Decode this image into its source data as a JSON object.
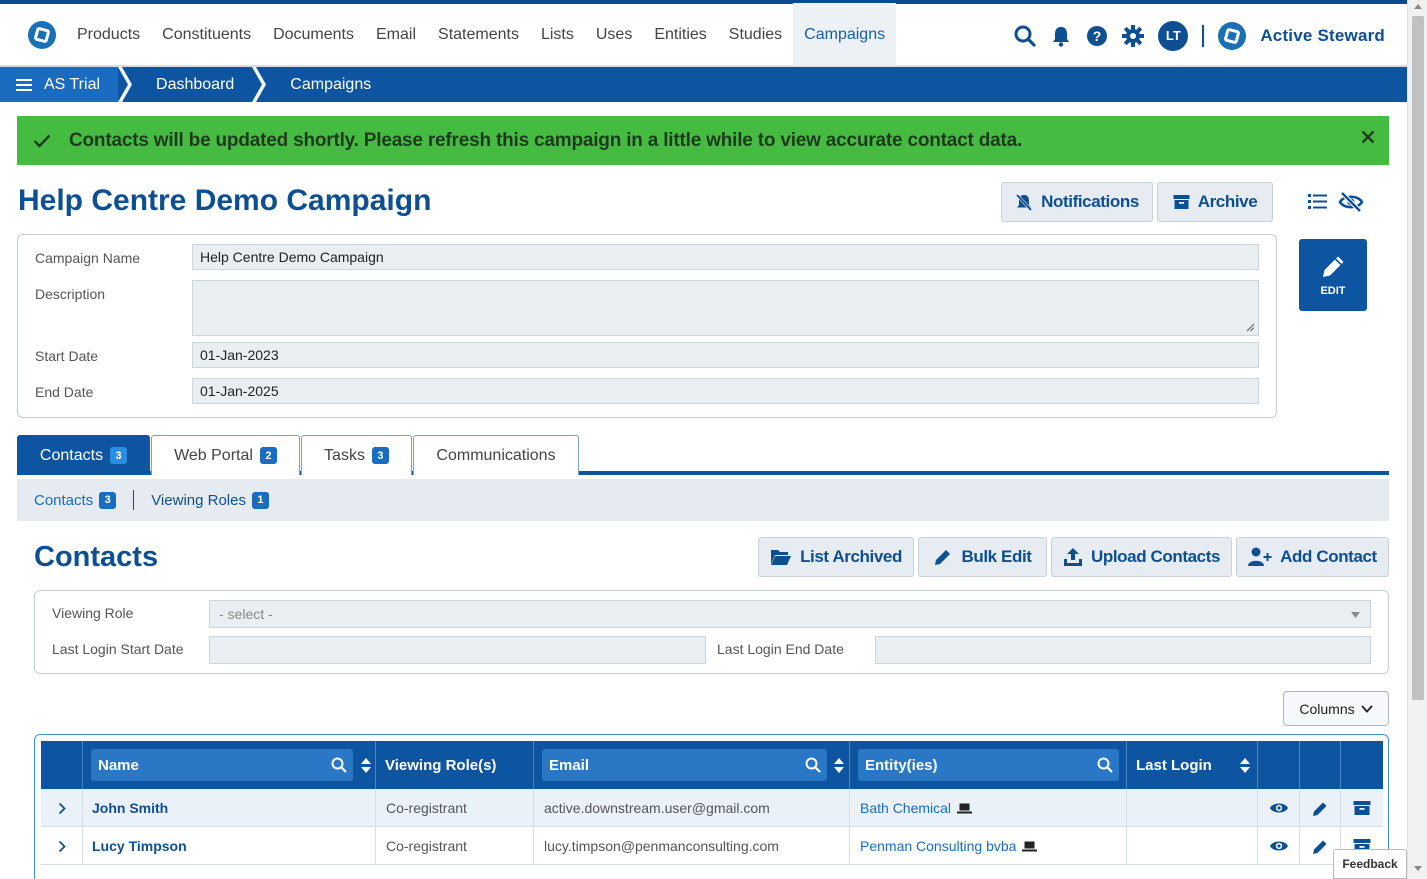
{
  "nav": {
    "items": [
      "Products",
      "Constituents",
      "Documents",
      "Email",
      "Statements",
      "Lists",
      "Uses",
      "Entities",
      "Studies",
      "Campaigns"
    ],
    "active": "Campaigns",
    "user_initials": "LT",
    "brand": "Active Steward",
    "icons": [
      "search-icon",
      "bell-icon",
      "help-icon",
      "gear-icon"
    ]
  },
  "breadcrumb": [
    "AS Trial",
    "Dashboard",
    "Campaigns"
  ],
  "alert": {
    "text": "Contacts will be updated shortly. Please refresh this campaign in a little while to view accurate contact data.",
    "color": "#45bc41"
  },
  "page": {
    "title": "Help Centre Demo Campaign",
    "notifications_label": "Notifications",
    "archive_label": "Archive",
    "edit_label": "EDIT"
  },
  "form": {
    "campaign_name_label": "Campaign Name",
    "campaign_name_value": "Help Centre Demo Campaign",
    "description_label": "Description",
    "description_value": "",
    "start_date_label": "Start Date",
    "start_date_value": "01-Jan-2023",
    "end_date_label": "End Date",
    "end_date_value": "01-Jan-2025"
  },
  "tabs": [
    {
      "label": "Contacts",
      "count": "3"
    },
    {
      "label": "Web Portal",
      "count": "2"
    },
    {
      "label": "Tasks",
      "count": "3"
    },
    {
      "label": "Communications",
      "count": ""
    }
  ],
  "subnav": [
    {
      "label": "Contacts",
      "count": "3"
    },
    {
      "label": "Viewing Roles",
      "count": "1"
    }
  ],
  "contacts": {
    "heading": "Contacts",
    "list_archived_label": "List Archived",
    "bulk_edit_label": "Bulk Edit",
    "upload_contacts_label": "Upload Contacts",
    "add_contact_label": "Add Contact"
  },
  "filters": {
    "viewing_role_label": "Viewing Role",
    "viewing_role_placeholder": "- select -",
    "last_login_start_label": "Last Login Start Date",
    "last_login_end_label": "Last Login End Date"
  },
  "columns_label": "Columns",
  "table": {
    "headers": [
      "Name",
      "Viewing Role(s)",
      "Email",
      "Entity(ies)",
      "Last Login"
    ],
    "rows": [
      {
        "name": "John Smith",
        "role": "Co-registrant",
        "email": "active.downstream.user@gmail.com",
        "entity": "Bath Chemical",
        "last_login": ""
      },
      {
        "name": "Lucy Timpson",
        "role": "Co-registrant",
        "email": "lucy.timpson@penmanconsulting.com",
        "entity": "Penman Consulting bvba",
        "last_login": ""
      }
    ]
  },
  "feedback_label": "Feedback"
}
